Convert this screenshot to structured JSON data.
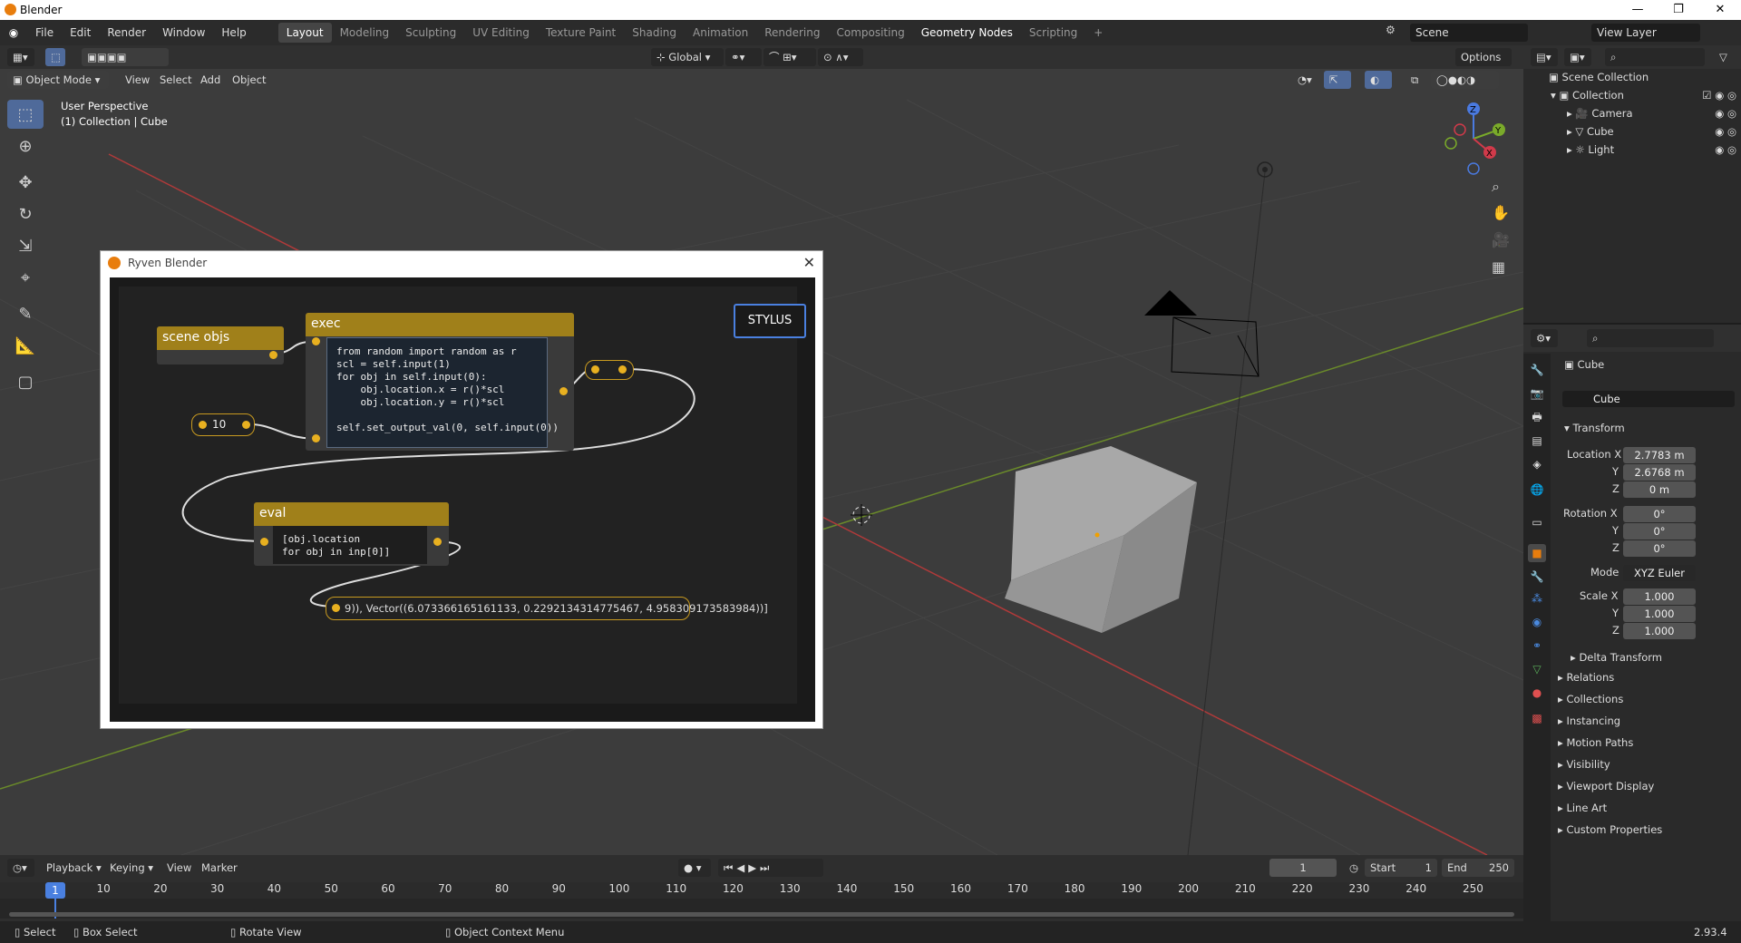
{
  "window": {
    "title": "Blender",
    "minimize": "—",
    "maximize": "❐",
    "close": "✕"
  },
  "menus": [
    "File",
    "Edit",
    "Render",
    "Window",
    "Help"
  ],
  "workspaces": [
    "Layout",
    "Modeling",
    "Sculpting",
    "UV Editing",
    "Texture Paint",
    "Shading",
    "Animation",
    "Rendering",
    "Compositing",
    "Geometry Nodes",
    "Scripting"
  ],
  "workspace_add": "+",
  "scene": {
    "label": "Scene",
    "view_layer": "View Layer"
  },
  "header": {
    "orientation": "Global",
    "options": "Options",
    "mode": "Object Mode",
    "menus": [
      "View",
      "Select",
      "Add",
      "Object"
    ]
  },
  "viewport": {
    "perspective": "User Perspective",
    "collection": "(1) Collection | Cube",
    "gizmo": {
      "z": "Z",
      "y": "Y",
      "x": "X"
    }
  },
  "ryven": {
    "title": "Ryven Blender",
    "stylus": "STYLUS",
    "nodes": {
      "scene_objs": "scene objs",
      "exec": "exec",
      "eval": "eval",
      "value": "10"
    },
    "exec_code": "from random import random as r\nscl = self.input(1)\nfor obj in self.input(0):\n    obj.location.x = r()*scl\n    obj.location.y = r()*scl\n\nself.set_output_val(0, self.input(0))",
    "eval_code": "[obj.location\nfor obj in inp[0]]",
    "output": "9)), Vector((6.073366165161133, 0.2292134314775467, 4.958309173583984))]"
  },
  "outliner": {
    "root": "Scene Collection",
    "collection": "Collection",
    "items": [
      "Camera",
      "Cube",
      "Light"
    ]
  },
  "properties": {
    "object": "Cube",
    "data": "Cube",
    "transform": "Transform",
    "location": {
      "label": "Location X",
      "x": "2.7783 m",
      "y": "2.6768 m",
      "z": "0 m"
    },
    "rotation": {
      "label": "Rotation X",
      "x": "0°",
      "y": "0°",
      "z": "0°"
    },
    "mode_label": "Mode",
    "mode": "XYZ Euler",
    "scale": {
      "label": "Scale X",
      "x": "1.000",
      "y": "1.000",
      "z": "1.000"
    },
    "axis": {
      "y": "Y",
      "z": "Z"
    },
    "delta": "Delta Transform",
    "sections": [
      "Relations",
      "Collections",
      "Instancing",
      "Motion Paths",
      "Visibility",
      "Viewport Display",
      "Line Art",
      "Custom Properties"
    ]
  },
  "timeline": {
    "menus": [
      "Playback",
      "Keying",
      "View",
      "Marker"
    ],
    "current_frame": "1",
    "start_label": "Start",
    "start": "1",
    "end_label": "End",
    "end": "250",
    "ticks": [
      "1",
      "10",
      "20",
      "30",
      "40",
      "50",
      "60",
      "70",
      "80",
      "90",
      "100",
      "110",
      "120",
      "130",
      "140",
      "150",
      "160",
      "170",
      "180",
      "190",
      "200",
      "210",
      "220",
      "230",
      "240",
      "250"
    ]
  },
  "status": {
    "select": "Select",
    "box_select": "Box Select",
    "rotate": "Rotate View",
    "context": "Object Context Menu",
    "version": "2.93.4"
  },
  "colors": {
    "accent": "#4f6a9a",
    "node_header": "#a0801a",
    "pin": "#e8b020"
  }
}
